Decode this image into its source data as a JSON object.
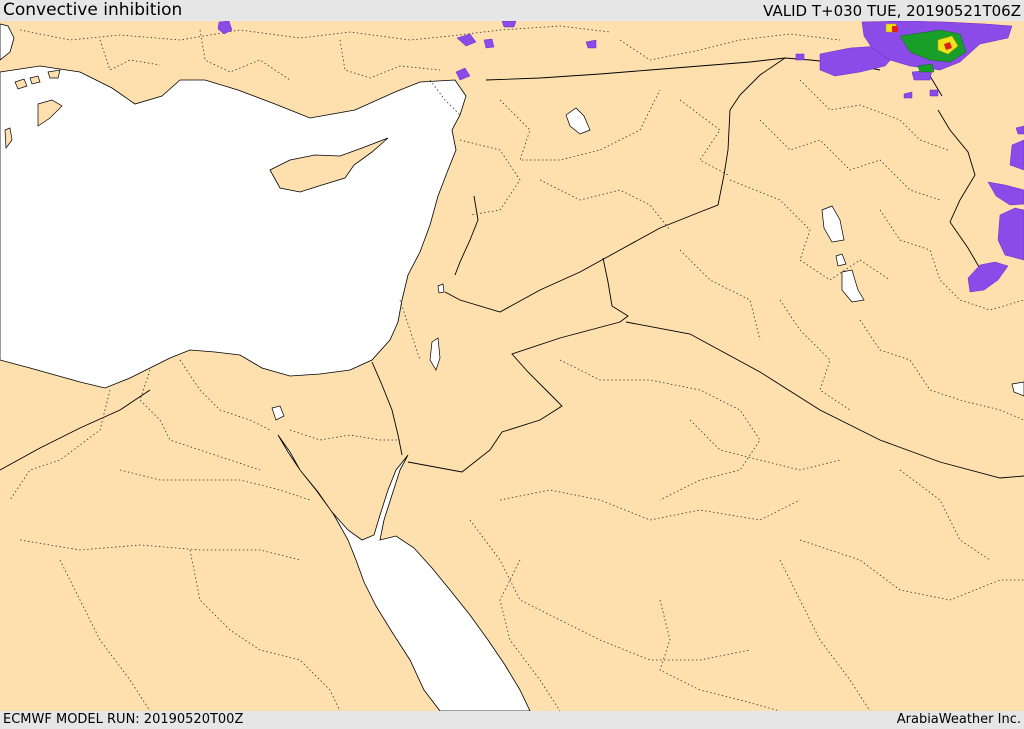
{
  "header": {
    "title": "Convective inhibition",
    "valid": "VALID T+030 TUE, 20190521T06Z"
  },
  "footer": {
    "model_run": "ECMWF MODEL RUN: 20190520T00Z",
    "credit": "ArabiaWeather Inc."
  },
  "map": {
    "land_color": "#fde0ae",
    "sea_color": "#ffffff",
    "border_color": "#000000",
    "cin_colors": [
      "#8a4be8",
      "#1a9e2a",
      "#f2e41a",
      "#e02020"
    ]
  }
}
